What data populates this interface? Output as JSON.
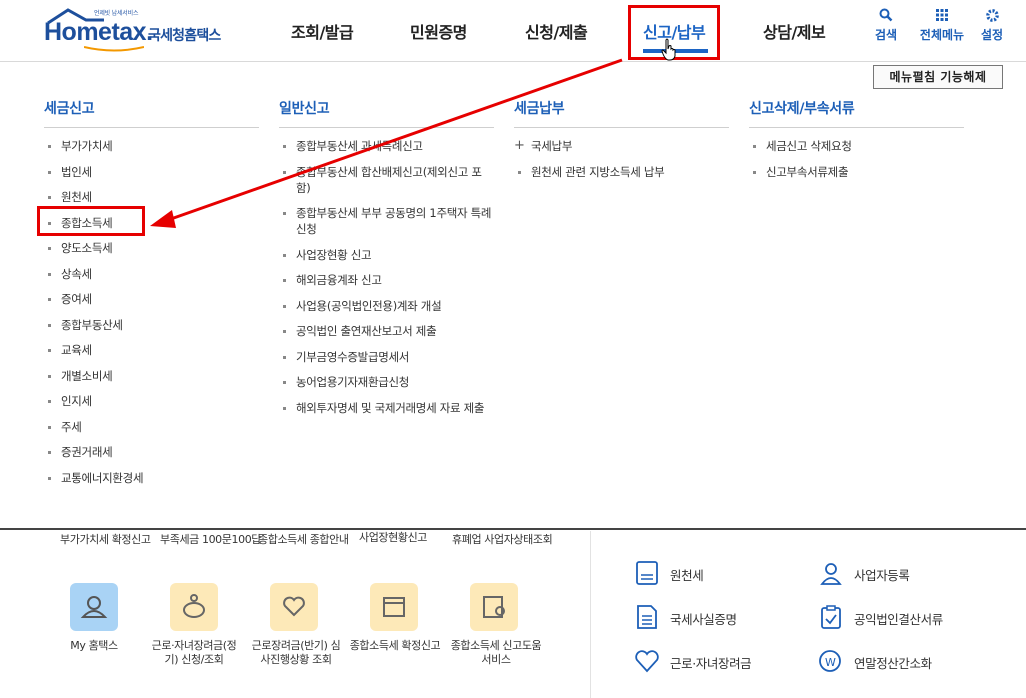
{
  "header": {
    "logo_caption": "언제빗 납세서비스",
    "logo_brand": "Hometax.",
    "logo_korean": "국세청홈택스",
    "nav": [
      "조회/발급",
      "민원증명",
      "신청/제출",
      "신고/납부",
      "상담/제보"
    ],
    "active_nav": "신고/납부",
    "utils": {
      "search": "검색",
      "all_menu": "전체메뉴",
      "settings": "설정"
    }
  },
  "menu_panel": {
    "fold_button": "메뉴펼침 기능해제",
    "columns": [
      {
        "title": "세금신고",
        "items": [
          "부가가치세",
          "법인세",
          "원천세",
          "종합소득세",
          "양도소득세",
          "상속세",
          "증여세",
          "종합부동산세",
          "교육세",
          "개별소비세",
          "인지세",
          "주세",
          "증권거래세",
          "교통에너지환경세"
        ]
      },
      {
        "title": "일반신고",
        "items": [
          "종합부동산세 과세특례신고",
          "종합부동산세 합산배제신고(제외신고 포함)",
          "종합부동산세 부부 공동명의 1주택자 특례 신청",
          "사업장현황 신고",
          "해외금융계좌 신고",
          "사업용(공익법인전용)계좌 개설",
          "공익법인 출연재산보고서 제출",
          "기부금영수증발급명세서",
          "농어업용기자재환급신청",
          "해외투자명세 및 국제거래명세 자료 제출"
        ]
      },
      {
        "title": "세금납부",
        "items": [
          "국세납부",
          "원천세 관련 지방소득세 납부"
        ]
      },
      {
        "title": "신고삭제/부속서류",
        "items": [
          "세금신고 삭제요청",
          "신고부속서류제출"
        ]
      }
    ]
  },
  "background_page": {
    "top_row_labels": [
      "부가가치세 확정신고",
      "부족세금 100문100답",
      "종합소득세 종합안내",
      "사업장현황신고",
      "휴폐업 사업자상태조회"
    ],
    "quick_services": [
      "My 홈택스",
      "근로·자녀장려금(정기) 신청/조회",
      "근로장려금(반기) 심사진행상황 조회",
      "종합소득세 확정신고",
      "종합소득세 신고도움 서비스"
    ],
    "right_links": [
      "원천세",
      "사업자등록",
      "국세사실증명",
      "공익법인결산서류",
      "근로·자녀장려금",
      "연말정산간소화"
    ]
  },
  "annotation_color": "#e60000",
  "accent_color": "#1c64c4"
}
